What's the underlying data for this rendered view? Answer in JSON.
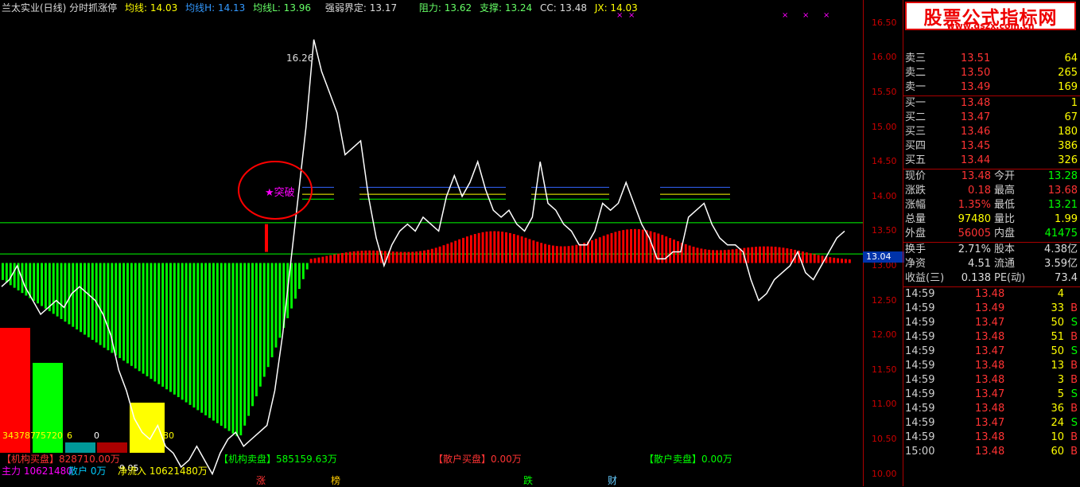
{
  "header": {
    "title": "兰太实业(日线) 分时抓涨停",
    "ma": "均线: 14.03",
    "ma_h": "均线H: 14.13",
    "ma_l": "均线L: 13.96",
    "strength": "强弱界定: 13.17",
    "resistance": "阻力: 13.62",
    "support": "支撑: 13.24",
    "cc": "CC: 13.48",
    "jx": "JX: 14.03"
  },
  "chart": {
    "peak_label": "16.26",
    "breakout_label": "★突破",
    "current_price_box": "13.04",
    "y_ticks": [
      "16.50",
      "16.00",
      "15.50",
      "15.00",
      "14.50",
      "14.00",
      "13.50",
      "13.00",
      "12.50",
      "12.00",
      "11.50",
      "11.00",
      "10.50",
      "10.00"
    ],
    "y_range": [
      9.95,
      16.6
    ],
    "colors": {
      "red": "#ff0000",
      "green": "#00ff00",
      "yellow": "#ffff00",
      "white": "#ffffff",
      "magenta": "#ff00ff"
    }
  },
  "chart_data": {
    "type": "line",
    "title": "分时抓涨停",
    "xlabel": "",
    "ylabel": "",
    "ylim": [
      9.95,
      16.6
    ],
    "series": [
      {
        "values": [
          12.7,
          12.8,
          13.0,
          12.7,
          12.5,
          12.3,
          12.4,
          12.5,
          12.4,
          12.6,
          12.7,
          12.6,
          12.5,
          12.3,
          12.0,
          11.5,
          11.2,
          10.8,
          10.6,
          10.5,
          10.7,
          10.4,
          10.3,
          10.1,
          10.2,
          10.4,
          10.2,
          10.0,
          10.3,
          10.5,
          10.6,
          10.4,
          10.5,
          10.6,
          10.7,
          11.2,
          12.0,
          13.0,
          14.0,
          15.0,
          16.26,
          15.8,
          15.5,
          15.2,
          14.6,
          14.7,
          14.8,
          14.0,
          13.4,
          13.0,
          13.3,
          13.5,
          13.6,
          13.5,
          13.7,
          13.6,
          13.5,
          14.0,
          14.3,
          14.0,
          14.2,
          14.5,
          14.1,
          13.8,
          13.7,
          13.8,
          13.6,
          13.5,
          13.7,
          14.5,
          13.9,
          13.8,
          13.6,
          13.5,
          13.3,
          13.3,
          13.5,
          13.9,
          13.8,
          13.9,
          14.2,
          13.9,
          13.6,
          13.4,
          13.1,
          13.1,
          13.2,
          13.2,
          13.7,
          13.8,
          13.9,
          13.6,
          13.4,
          13.3,
          13.3,
          13.2,
          12.8,
          12.5,
          12.6,
          12.8,
          12.9,
          13.0,
          13.2,
          12.9,
          12.8,
          13.0,
          13.2,
          13.4,
          13.5
        ]
      }
    ],
    "volume_bars": {
      "note_colors": "red above 13.17, green below"
    }
  },
  "left_bars": {
    "labels": [
      "343787",
      "75720",
      "6",
      "0",
      "9.05",
      "80"
    ]
  },
  "legends": {
    "inst_buy": "【机构买盘】828710.00万",
    "inst_sell": "【机构卖盘】585159.63万",
    "retail_buy": "【散户买盘】0.00万",
    "retail_sell": "【散户卖盘】0.00万",
    "main_force": "主力 10621480",
    "retail": "散户 0万",
    "net_inflow": "净流入 10621480万"
  },
  "bottom_tabs": [
    "涨",
    "榜",
    "跌",
    "财"
  ],
  "watermark": {
    "title": "股票公式指标网",
    "url": "www.gszx.com.cn"
  },
  "order_book": {
    "sell": [
      {
        "label": "卖三",
        "price": "13.51",
        "vol": "64"
      },
      {
        "label": "卖二",
        "price": "13.50",
        "vol": "265"
      },
      {
        "label": "卖一",
        "price": "13.49",
        "vol": "169"
      }
    ],
    "buy": [
      {
        "label": "买一",
        "price": "13.48",
        "vol": "1"
      },
      {
        "label": "买二",
        "price": "13.47",
        "vol": "67"
      },
      {
        "label": "买三",
        "price": "13.46",
        "vol": "180"
      },
      {
        "label": "买四",
        "price": "13.45",
        "vol": "386"
      },
      {
        "label": "买五",
        "price": "13.44",
        "vol": "326"
      }
    ]
  },
  "quote": [
    {
      "l1": "现价",
      "v1": "13.48",
      "l2": "今开",
      "v2": "13.28",
      "c1": "#ff3333",
      "c2": "#00ff00"
    },
    {
      "l1": "涨跌",
      "v1": "0.18",
      "l2": "最高",
      "v2": "13.68",
      "c1": "#ff3333",
      "c2": "#ff3333"
    },
    {
      "l1": "涨幅",
      "v1": "1.35%",
      "l2": "最低",
      "v2": "13.21",
      "c1": "#ff3333",
      "c2": "#00ff00"
    },
    {
      "l1": "总量",
      "v1": "97480",
      "l2": "量比",
      "v2": "1.99",
      "c1": "#ffff00",
      "c2": "#ffff00"
    },
    {
      "l1": "外盘",
      "v1": "56005",
      "l2": "内盘",
      "v2": "41475",
      "c1": "#ff3333",
      "c2": "#00ff00"
    }
  ],
  "fundamentals": [
    {
      "l1": "换手",
      "v1": "2.71%",
      "l2": "股本",
      "v2": "4.38亿"
    },
    {
      "l1": "净资",
      "v1": "4.51",
      "l2": "流通",
      "v2": "3.59亿"
    },
    {
      "l1": "收益(三)",
      "v1": "0.138",
      "l2": "PE(动)",
      "v2": "73.4"
    }
  ],
  "ticks": [
    {
      "t": "14:59",
      "p": "13.48",
      "v": "4",
      "d": ""
    },
    {
      "t": "14:59",
      "p": "13.49",
      "v": "33",
      "d": "B"
    },
    {
      "t": "14:59",
      "p": "13.47",
      "v": "50",
      "d": "S"
    },
    {
      "t": "14:59",
      "p": "13.48",
      "v": "51",
      "d": "B"
    },
    {
      "t": "14:59",
      "p": "13.47",
      "v": "50",
      "d": "S"
    },
    {
      "t": "14:59",
      "p": "13.48",
      "v": "13",
      "d": "B"
    },
    {
      "t": "14:59",
      "p": "13.48",
      "v": "3",
      "d": "B"
    },
    {
      "t": "14:59",
      "p": "13.47",
      "v": "5",
      "d": "S"
    },
    {
      "t": "14:59",
      "p": "13.48",
      "v": "36",
      "d": "B"
    },
    {
      "t": "14:59",
      "p": "13.47",
      "v": "24",
      "d": "S"
    },
    {
      "t": "14:59",
      "p": "13.48",
      "v": "10",
      "d": "B"
    },
    {
      "t": "15:00",
      "p": "13.48",
      "v": "60",
      "d": "B"
    }
  ]
}
